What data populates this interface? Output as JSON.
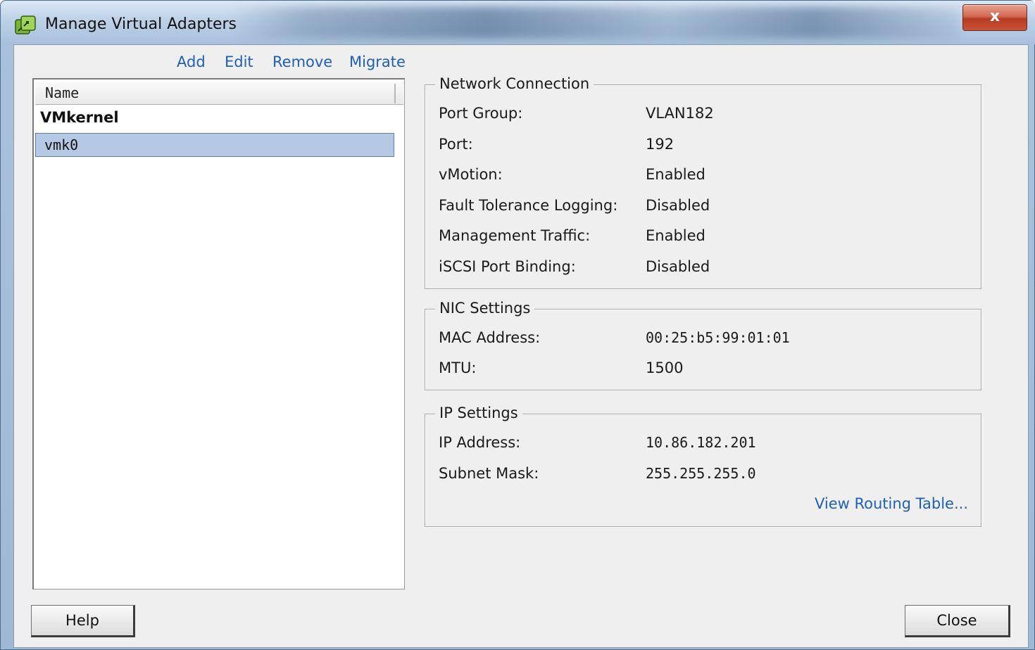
{
  "window": {
    "title": "Manage Virtual Adapters",
    "close_glyph": "x"
  },
  "toolbar": {
    "add": "Add",
    "edit": "Edit",
    "remove": "Remove",
    "migrate": "Migrate"
  },
  "adapter_list": {
    "column_header": "Name",
    "group_label": "VMkernel",
    "items": [
      {
        "label": "vmk0",
        "selected": true
      }
    ]
  },
  "network_connection": {
    "title": "Network Connection",
    "rows": [
      {
        "label": "Port Group:",
        "value": "VLAN182"
      },
      {
        "label": "Port:",
        "value": "192"
      },
      {
        "label": "vMotion:",
        "value": "Enabled"
      },
      {
        "label": "Fault Tolerance Logging:",
        "value": "Disabled"
      },
      {
        "label": "Management Traffic:",
        "value": "Enabled"
      },
      {
        "label": "iSCSI Port Binding:",
        "value": "Disabled"
      }
    ]
  },
  "nic_settings": {
    "title": "NIC Settings",
    "rows": [
      {
        "label": "MAC Address:",
        "value": "00:25:b5:99:01:01"
      },
      {
        "label": "MTU:",
        "value": "1500"
      }
    ]
  },
  "ip_settings": {
    "title": "IP Settings",
    "rows": [
      {
        "label": "IP Address:",
        "value": "10.86.182.201"
      },
      {
        "label": "Subnet Mask:",
        "value": "255.255.255.0"
      }
    ],
    "routing_link": "View Routing Table..."
  },
  "buttons": {
    "help": "Help",
    "close": "Close"
  },
  "colors": {
    "link": "#1f5fb8",
    "selection": "#b6c9e4",
    "dialog_bg": "#efefef",
    "close_button": "#c8533a"
  },
  "icons": {
    "app": "vsphere-network-icon",
    "close": "close-icon"
  }
}
